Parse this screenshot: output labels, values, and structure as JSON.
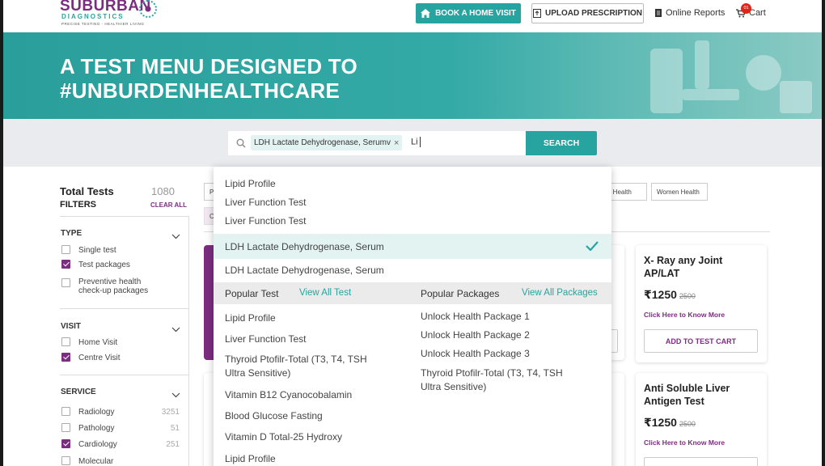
{
  "header": {
    "logo_main": "SUBURBAN",
    "logo_sub": "DIAGNOSTICS",
    "logo_tag": "PRECISE TESTING · HEALTHIER LIVING",
    "book_home_visit": "BOOK A HOME VISIT",
    "upload_prescription": "UPLOAD PRESCRIPTION",
    "online_reports": "Online Reports",
    "cart": "Cart",
    "cart_count": "01"
  },
  "hero": {
    "line1": "A TEST MENU DESIGNED TO",
    "line2": "#UNBURDENHEALTHCARE"
  },
  "search": {
    "chip": "LDH Lactate Dehydrogenase, Serumv",
    "typed": "Li",
    "button": "SEARCH"
  },
  "sidebar": {
    "total_label": "Total Tests",
    "total_count": "1080",
    "filters_label": "FILTERS",
    "clear_all": "CLEAR ALL",
    "type": {
      "title": "TYPE",
      "options": [
        {
          "label": "Single test",
          "checked": false
        },
        {
          "label": "Test packages",
          "checked": true
        },
        {
          "label": "Preventive health check-up packages",
          "checked": false
        }
      ]
    },
    "visit": {
      "title": "VISIT",
      "options": [
        {
          "label": "Home Visit",
          "checked": false
        },
        {
          "label": "Centre Visit",
          "checked": true
        }
      ]
    },
    "service": {
      "title": "SERVICE",
      "options": [
        {
          "label": "Radiology",
          "count": "3251",
          "checked": false
        },
        {
          "label": "Pathology",
          "count": "51",
          "checked": false
        },
        {
          "label": "Cardiology",
          "count": "251",
          "checked": true
        },
        {
          "label": "Molecular",
          "count": "",
          "checked": false
        }
      ]
    }
  },
  "tags": {
    "first_partial": "P",
    "second_partial": "Ce",
    "health_partial": "n Health",
    "women_health": "Women Health"
  },
  "cards": [
    {
      "title": "X- Ray any Joint AP/LAT",
      "price": "₹1250",
      "old_price": "2500",
      "link": "Click Here to Know More",
      "button": "ADD TO TEST CART"
    },
    {
      "title": "Anti Soluble Liver Antigen Test",
      "price": "₹1250",
      "old_price": "2500",
      "link": "Click Here to Know More"
    }
  ],
  "dropdown": {
    "suggestions": [
      "Lipid Profile",
      "Liver Function Test",
      "Liver Function Test"
    ],
    "selected": "LDH Lactate Dehydrogenase, Serum",
    "after_selected": "LDH Lactate Dehydrogenase, Serum",
    "popular_test_title": "Popular Test",
    "view_all_test": "View All Test",
    "popular_packages_title": "Popular Packages",
    "view_all_packages": "View All Packages",
    "popular_tests": [
      "Lipid Profile",
      "Liver Function Test",
      "Thyroid Ptofilr-Total (T3, T4, TSH Ultra Sensitive)",
      "Vitamin B12 Cyanocobalamin",
      "Blood Glucose Fasting",
      "Vitamin D Total-25 Hydroxy",
      "Lipid Profile"
    ],
    "popular_packages": [
      "Unlock Health Package 1",
      "Unlock Health Package 2",
      "Unlock Health Package 3",
      "Thyroid Ptofilr-Total (T3, T4, TSH Ultra Sensitive)"
    ]
  },
  "colors": {
    "teal": "#27a3a0",
    "purple": "#7b2d7f"
  }
}
